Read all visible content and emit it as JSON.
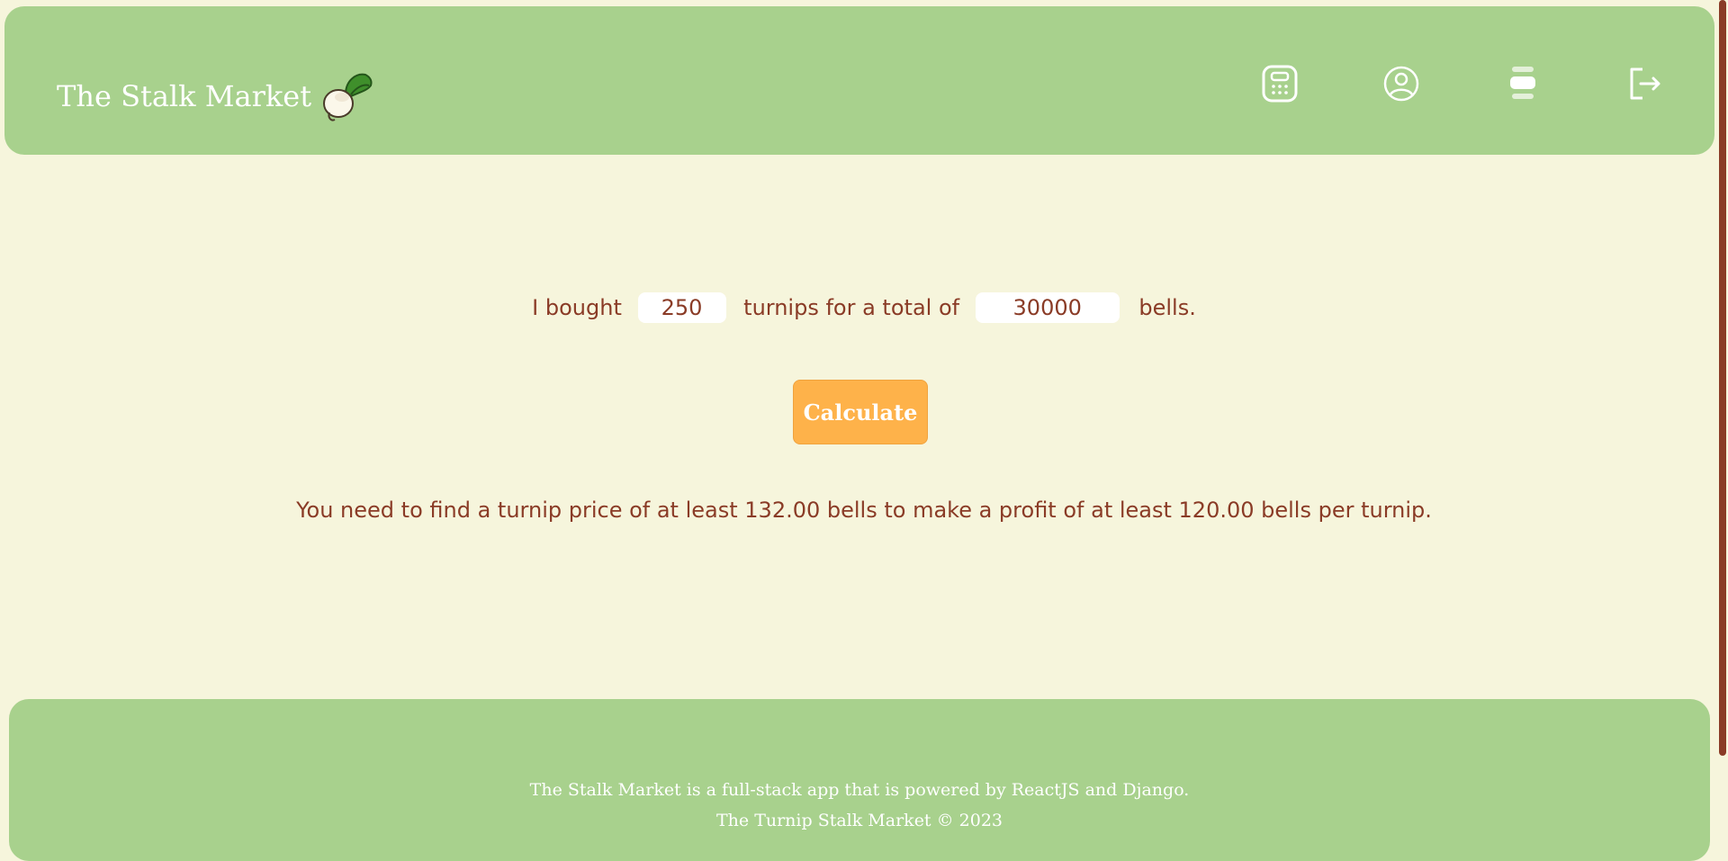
{
  "header": {
    "brand": "The Stalk Market",
    "nav": [
      {
        "icon": "calculator-icon",
        "name": "calculator"
      },
      {
        "icon": "user-circle-icon",
        "name": "profile"
      },
      {
        "icon": "list-icon",
        "name": "list"
      },
      {
        "icon": "logout-icon",
        "name": "logout"
      }
    ]
  },
  "form": {
    "text_before": "I bought",
    "turnips_value": "250",
    "text_middle": "turnips for a total of",
    "bells_value": "30000",
    "text_after": "bells."
  },
  "calculate_label": "Calculate",
  "result": "You need to find a turnip price of at least 132.00 bells to make a profit of at least 120.00 bells per turnip.",
  "footer": {
    "line1": "The Stalk Market is a full-stack app that is powered by ReactJS and Django.",
    "line2": "The Turnip Stalk Market © 2023"
  },
  "colors": {
    "background": "#f6f5dc",
    "header_green": "#a8d18d",
    "text_brown": "#8a3b26",
    "button_orange": "#feb24a"
  }
}
